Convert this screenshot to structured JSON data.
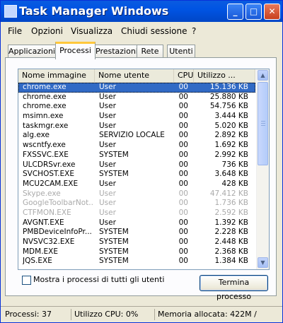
{
  "window": {
    "title": "Task Manager Windows",
    "buttons": {
      "minimize": "_",
      "maximize": "□",
      "close": "✕"
    }
  },
  "menu": [
    "File",
    "Opzioni",
    "Visualizza",
    "Chiudi sessione",
    "?"
  ],
  "tabs": [
    "Applicazioni",
    "Processi",
    "Prestazioni",
    "Rete",
    "Utenti"
  ],
  "active_tab": "Processi",
  "table": {
    "headers": [
      "Nome immagine",
      "Nome utente",
      "CPU",
      "Utilizzo ..."
    ],
    "rows": [
      {
        "name": "chrome.exe",
        "user": "User",
        "cpu": "00",
        "mem": "15.136 KB",
        "selected": true,
        "dim": false
      },
      {
        "name": "chrome.exe",
        "user": "User",
        "cpu": "00",
        "mem": "25.880 KB",
        "selected": false,
        "dim": false
      },
      {
        "name": "chrome.exe",
        "user": "User",
        "cpu": "00",
        "mem": "54.756 KB",
        "selected": false,
        "dim": false
      },
      {
        "name": "msimn.exe",
        "user": "User",
        "cpu": "00",
        "mem": "3.444 KB",
        "selected": false,
        "dim": false
      },
      {
        "name": "taskmgr.exe",
        "user": "User",
        "cpu": "00",
        "mem": "5.020 KB",
        "selected": false,
        "dim": false
      },
      {
        "name": "alg.exe",
        "user": "SERVIZIO LOCALE",
        "cpu": "00",
        "mem": "2.892 KB",
        "selected": false,
        "dim": false
      },
      {
        "name": "wscntfy.exe",
        "user": "User",
        "cpu": "00",
        "mem": "1.692 KB",
        "selected": false,
        "dim": false
      },
      {
        "name": "FXSSVC.EXE",
        "user": "SYSTEM",
        "cpu": "00",
        "mem": "2.992 KB",
        "selected": false,
        "dim": false
      },
      {
        "name": "ULCDRSvr.exe",
        "user": "User",
        "cpu": "00",
        "mem": "736 KB",
        "selected": false,
        "dim": false
      },
      {
        "name": "SVCHOST.EXE",
        "user": "SYSTEM",
        "cpu": "00",
        "mem": "3.648 KB",
        "selected": false,
        "dim": false
      },
      {
        "name": "MCU2CAM.EXE",
        "user": "User",
        "cpu": "00",
        "mem": "428 KB",
        "selected": false,
        "dim": false
      },
      {
        "name": "Skype.exe",
        "user": "User",
        "cpu": "00",
        "mem": "47.412 KB",
        "selected": false,
        "dim": true
      },
      {
        "name": "GoogleToolbarNot...",
        "user": "User",
        "cpu": "00",
        "mem": "1.736 KB",
        "selected": false,
        "dim": true
      },
      {
        "name": "CTFMON.EXE",
        "user": "User",
        "cpu": "00",
        "mem": "2.592 KB",
        "selected": false,
        "dim": true
      },
      {
        "name": "AVGNT.EXE",
        "user": "User",
        "cpu": "00",
        "mem": "1.392 KB",
        "selected": false,
        "dim": false
      },
      {
        "name": "PMBDeviceInfoPr...",
        "user": "SYSTEM",
        "cpu": "00",
        "mem": "2.228 KB",
        "selected": false,
        "dim": false
      },
      {
        "name": "NVSVC32.EXE",
        "user": "SYSTEM",
        "cpu": "00",
        "mem": "2.448 KB",
        "selected": false,
        "dim": false
      },
      {
        "name": "MDM.EXE",
        "user": "SYSTEM",
        "cpu": "00",
        "mem": "2.368 KB",
        "selected": false,
        "dim": false
      },
      {
        "name": "JQS.EXE",
        "user": "SYSTEM",
        "cpu": "00",
        "mem": "1.384 KB",
        "selected": false,
        "dim": false
      }
    ]
  },
  "show_all_users_label": "Mostra i processi di tutti gli utenti",
  "show_all_users_checked": false,
  "end_process_label": "Termina processo",
  "status": {
    "processes": "Processi: 37",
    "cpu": "Utilizzo CPU: 0%",
    "memory": "Memoria allocata: 422M /"
  },
  "colors": {
    "titlebar": "#0054e3",
    "selection": "#316ac5",
    "tab_highlight": "#ffc83c"
  },
  "icons": [
    "app-icon",
    "minimize-icon",
    "maximize-icon",
    "close-icon",
    "scroll-up-icon",
    "scroll-down-icon"
  ]
}
